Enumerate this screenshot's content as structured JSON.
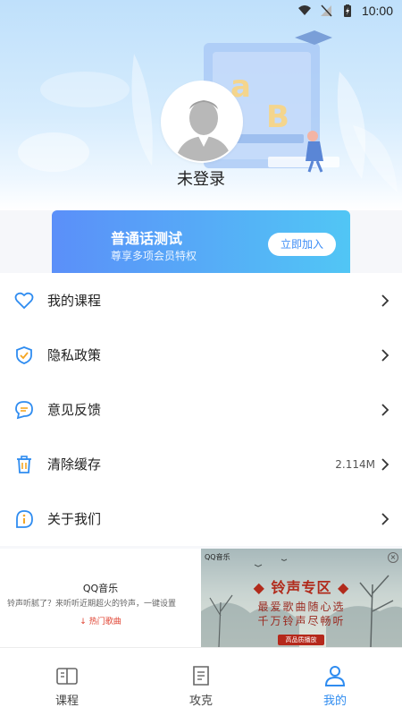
{
  "status_bar": {
    "time": "10:00"
  },
  "profile": {
    "login_status": "未登录"
  },
  "promo": {
    "title": "普通话测试",
    "subtitle": "尊享多项会员特权",
    "button": "立即加入"
  },
  "menu": {
    "items": [
      {
        "label": "我的课程",
        "value": "",
        "icon": "heart-icon"
      },
      {
        "label": "隐私政策",
        "value": "",
        "icon": "shield-check-icon"
      },
      {
        "label": "意见反馈",
        "value": "",
        "icon": "chat-bubble-icon"
      },
      {
        "label": "清除缓存",
        "value": "2.114M",
        "icon": "trash-icon"
      },
      {
        "label": "关于我们",
        "value": "",
        "icon": "info-icon"
      }
    ]
  },
  "ad": {
    "brand": "QQ音乐",
    "description": "铃声听腻了？来听听近期超火的铃声，一键设置",
    "hot_link": "热门歌曲",
    "banner_brand": "QQ音乐",
    "banner_title": "◆ 铃声专区 ◆",
    "banner_line1": "最爱歌曲随心选",
    "banner_line2": "千万铃声尽畅听",
    "banner_cta": "高品质播放"
  },
  "bottom_nav": {
    "tabs": [
      {
        "label": "课程",
        "active": false,
        "icon": "book-icon"
      },
      {
        "label": "攻克",
        "active": false,
        "icon": "document-icon"
      },
      {
        "label": "我的",
        "active": true,
        "icon": "person-icon"
      }
    ]
  },
  "colors": {
    "accent": "#2f8cf0",
    "promo_start": "#5b8ff9",
    "promo_end": "#51c6f5",
    "ad_red": "#b12a1b"
  }
}
